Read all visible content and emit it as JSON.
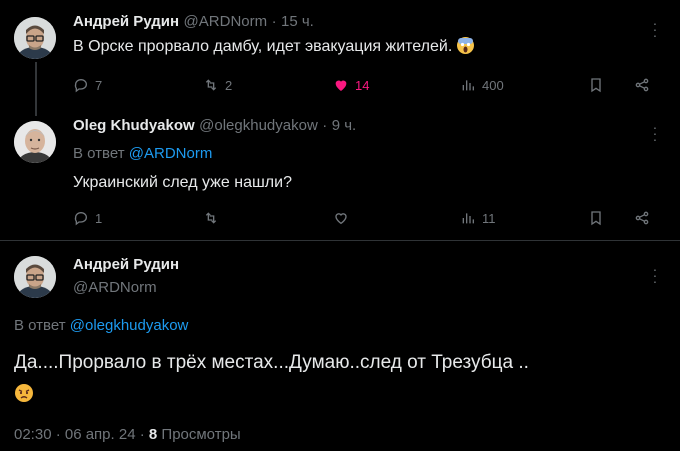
{
  "tweet1": {
    "name": "Андрей Рудин",
    "handle": "@ARDNorm",
    "sep": "·",
    "time": "15 ч.",
    "text": "В Орске прорвало дамбу, идет эвакуация жителей.",
    "emoji": "screaming-face-emoji",
    "replies": "7",
    "retweets": "2",
    "likes": "14",
    "views": "400"
  },
  "tweet2": {
    "name": "Oleg Khudyakow",
    "handle": "@olegkhudyakow",
    "sep": "·",
    "time": "9 ч.",
    "reply_prefix": "В ответ",
    "reply_to": "@ARDNorm",
    "text": "Украинский след уже нашли?",
    "replies": "1",
    "views": "11"
  },
  "tweet3": {
    "name": "Андрей Рудин",
    "handle": "@ARDNorm",
    "reply_prefix": "В ответ",
    "reply_to": "@olegkhudyakow",
    "text": "Да....Прорвало в трёх местах...Думаю..след от Трезубца ..",
    "emoji": "angry-face-emoji",
    "timestamp": "02:30 · 06 апр. 24 ·",
    "views_count": "8",
    "views_label": "Просмотры"
  },
  "colors": {
    "background": "#000000",
    "text": "#e7e9ea",
    "muted": "#71767b",
    "link": "#1d9bf0",
    "like": "#f91880"
  }
}
